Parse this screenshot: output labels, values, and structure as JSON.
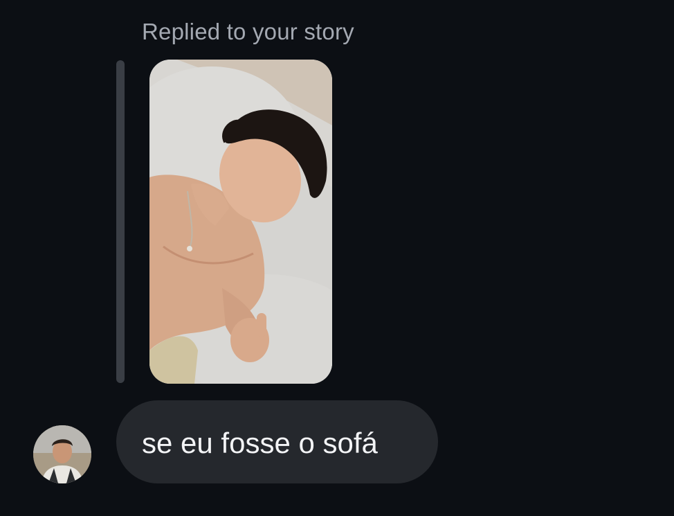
{
  "reply": {
    "label": "Replied to your story"
  },
  "story": {
    "thumbnail": "story-photo"
  },
  "message": {
    "text": "se eu fosse o sofá",
    "sender_avatar": "sender-avatar"
  },
  "colors": {
    "background": "#0c0f14",
    "bubble": "#25282d",
    "label": "#a4a9b2",
    "message_text": "#f3f4f6",
    "reply_bar": "#3a3e45"
  }
}
